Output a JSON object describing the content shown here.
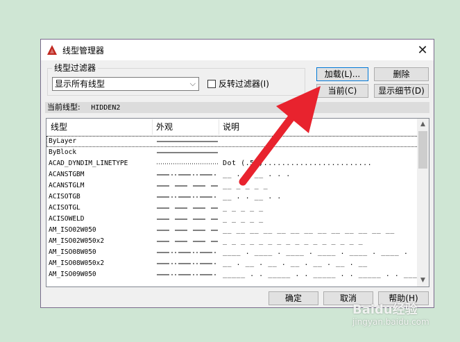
{
  "dialog": {
    "title": "线型管理器",
    "close_glyph": "✕"
  },
  "filter": {
    "legend": "线型过滤器",
    "selected": "显示所有线型",
    "invert_label": "反转过滤器(I)",
    "invert_checked": false
  },
  "buttons": {
    "load": "加载(L)...",
    "delete": "删除",
    "current": "当前(C)",
    "details": "显示细节(D)",
    "ok": "确定",
    "cancel": "取消",
    "help": "帮助(H)"
  },
  "current": {
    "label": "当前线型:",
    "value": "HIDDEN2"
  },
  "table": {
    "headers": [
      "线型",
      "外观",
      "说明"
    ],
    "rows": [
      {
        "name": "ByLayer",
        "pattern": "solid",
        "desc": ""
      },
      {
        "name": "ByBlock",
        "pattern": "solid",
        "desc": ""
      },
      {
        "name": "ACAD_DYNDIM_LINETYPE",
        "pattern": "dot",
        "desc": "Dot (.5x)........................"
      },
      {
        "name": "ACANSTGBM",
        "pattern": "dashdot",
        "desc": "__ . . __ . . ."
      },
      {
        "name": "ACANSTGLM",
        "pattern": "dash",
        "desc": "__ _ _ _ _"
      },
      {
        "name": "ACISOTGB",
        "pattern": "dashdot",
        "desc": "__ . . __ . ."
      },
      {
        "name": "ACISOTGL",
        "pattern": "dash",
        "desc": "_ _ _ _ _"
      },
      {
        "name": "ACISOWELD",
        "pattern": "dash",
        "desc": "_ _ _ _ _"
      },
      {
        "name": "AM_ISO02W050",
        "pattern": "dash",
        "desc": "__ __ __ __ __ __ __ __ __ __ __ __ __"
      },
      {
        "name": "AM_ISO02W050x2",
        "pattern": "dash",
        "desc": "_ _ _ _ _ _ _ _ _ _ _ _ _ _ _ _"
      },
      {
        "name": "AM_ISO08W050",
        "pattern": "dashdot",
        "desc": "____ . ____ . ____ . ____ . ____ . ____ ."
      },
      {
        "name": "AM_ISO08W050x2",
        "pattern": "dashdot",
        "desc": "__ . __ . __ . __ . __ . __ . __"
      },
      {
        "name": "AM_ISO09W050",
        "pattern": "dashdot",
        "desc": "_____ . . _____ . . _____ . . _____ . . _____"
      }
    ]
  },
  "watermark": {
    "logo": "Baidu经验",
    "url": "jingyan.baidu.com"
  },
  "colors": {
    "arrow": "#e8232e",
    "background": "#cfe6d4",
    "icon": "#c0271f"
  }
}
